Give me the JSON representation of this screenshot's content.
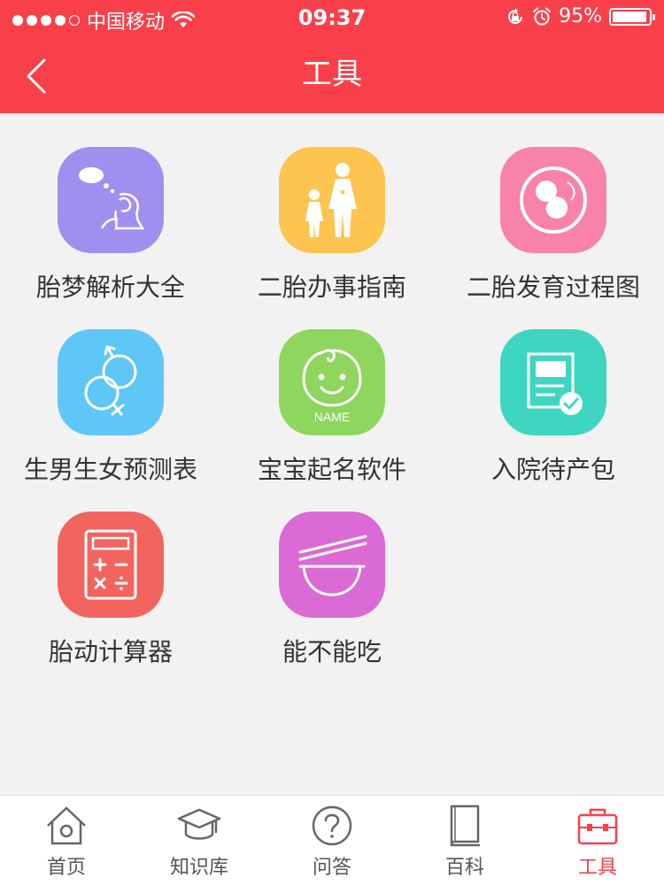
{
  "status_bar": {
    "carrier": "中国移动",
    "time": "09:37",
    "battery": "95%",
    "battery_level": 0.95
  },
  "header": {
    "title": "工具"
  },
  "tools": [
    {
      "label": "胎梦解析大全",
      "icon": "dream-icon",
      "color": "#a18ff0"
    },
    {
      "label": "二胎办事指南",
      "icon": "family-icon",
      "color": "#fdc54f"
    },
    {
      "label": "二胎发育过程图",
      "icon": "fetus-icon",
      "color": "#f882a8"
    },
    {
      "label": "生男生女预测表",
      "icon": "gender-icon",
      "color": "#5fc6f8"
    },
    {
      "label": "宝宝起名软件",
      "icon": "baby-face-icon",
      "icon_text": "NAME",
      "color": "#8ed65e"
    },
    {
      "label": "入院待产包",
      "icon": "checklist-icon",
      "color": "#3ed6c1"
    },
    {
      "label": "胎动计算器",
      "icon": "calculator-icon",
      "color": "#f4645f"
    },
    {
      "label": "能不能吃",
      "icon": "bowl-chopsticks-icon",
      "color": "#dc6ad6"
    }
  ],
  "tabbar": {
    "items": [
      {
        "label": "首页",
        "icon": "home-icon",
        "active": false
      },
      {
        "label": "知识库",
        "icon": "graduation-cap-icon",
        "active": false
      },
      {
        "label": "问答",
        "icon": "question-icon",
        "active": false
      },
      {
        "label": "百科",
        "icon": "book-icon",
        "active": false
      },
      {
        "label": "工具",
        "icon": "toolbox-icon",
        "active": true
      }
    ],
    "active_color": "#f9404a"
  }
}
